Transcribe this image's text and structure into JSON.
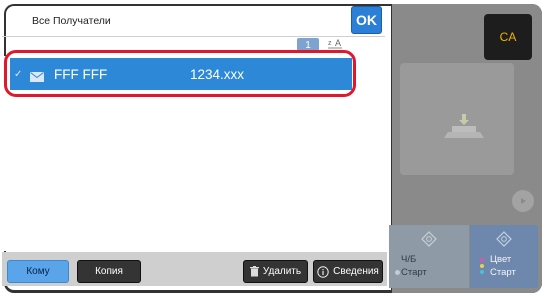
{
  "header": {
    "title": "Все Получатели",
    "ok_label": "OK",
    "count": "1"
  },
  "recipients": [
    {
      "name": "FFF FFF",
      "address": "1234.xxx",
      "selected": true,
      "icon": "mail-icon"
    }
  ],
  "toolbar": {
    "to_label": "Кому",
    "copy_label": "Копия",
    "delete_label": "Удалить",
    "info_label": "Сведения"
  },
  "right_panel": {
    "ca_label": "CA",
    "bw_label_line1": "Ч/Б",
    "bw_label_line2": "Старт",
    "color_label_line1": "Цвет",
    "color_label_line2": "Старт"
  },
  "colors": {
    "accent": "#2d88d8",
    "highlight": "#e0182d",
    "ca_text": "#f1b300"
  }
}
